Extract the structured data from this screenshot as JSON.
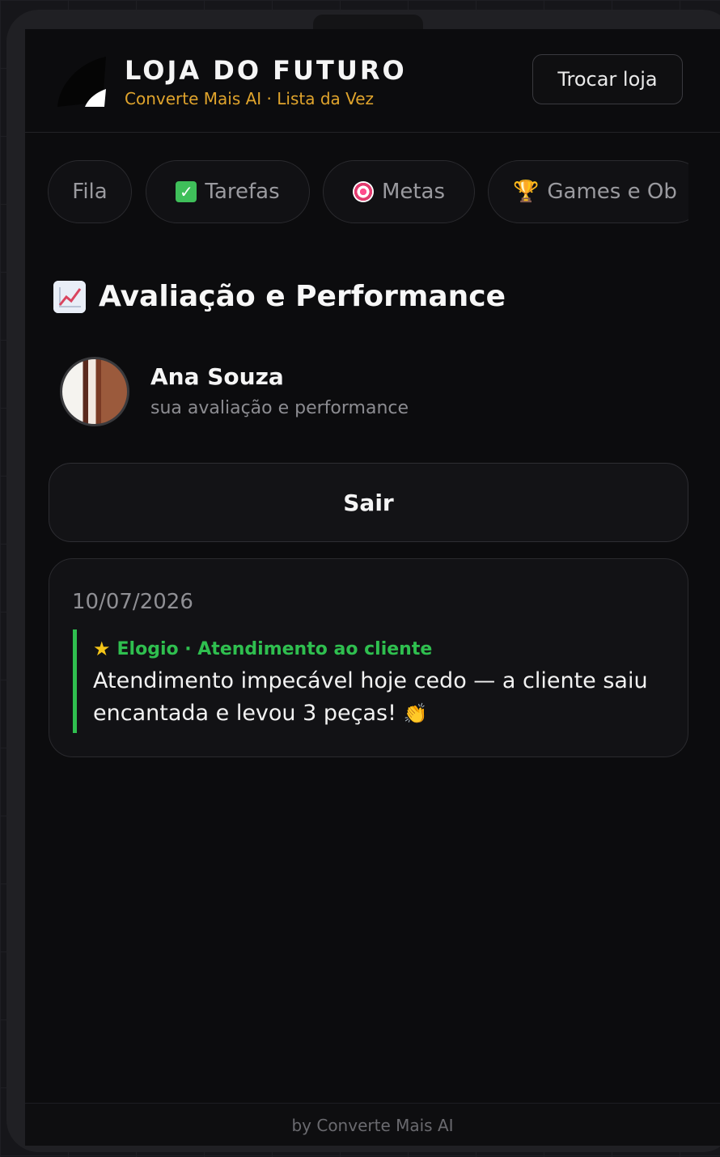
{
  "header": {
    "brand_title": "LOJA DO FUTURO",
    "brand_subtitle": "Converte Mais AI · Lista da Vez",
    "switch_store_label": "Trocar loja"
  },
  "tabs": [
    {
      "label": "Fila",
      "icon": ""
    },
    {
      "label": "Tarefas",
      "icon": "check-box-icon"
    },
    {
      "label": "Metas",
      "icon": "target-icon"
    },
    {
      "label": "Games e Ob",
      "icon": "trophy-icon"
    }
  ],
  "section": {
    "icon": "chart-increasing-icon",
    "title": "Avaliação e Performance"
  },
  "profile": {
    "name": "Ana Souza",
    "subtitle": "sua avaliação e performance"
  },
  "logout_label": "Sair",
  "feedback": {
    "date": "10/07/2026",
    "header": "Elogio · Atendimento ao cliente",
    "text": "Atendimento impecável hoje cedo — a cliente saiu encantada e levou 3 peças!",
    "accent_color": "#2fbf4f"
  },
  "footer": "by Converte Mais AI",
  "colors": {
    "brand_accent": "#e0a42c",
    "background": "#0c0c0e"
  }
}
